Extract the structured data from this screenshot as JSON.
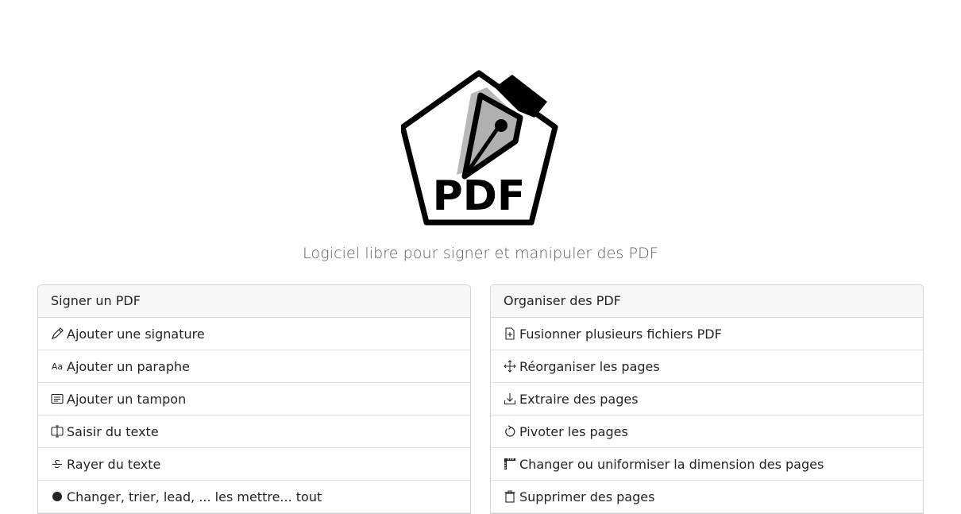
{
  "tagline": "Logiciel libre pour signer et manipuler des PDF",
  "logo": {
    "text": "PDF"
  },
  "sign_card": {
    "title": "Signer un PDF",
    "items": [
      {
        "label": "Ajouter une signature",
        "icon": "pen-icon"
      },
      {
        "label": "Ajouter un paraphe",
        "icon": "font-initials-icon",
        "icon_text": "Aa"
      },
      {
        "label": "Ajouter un tampon",
        "icon": "card-text-icon"
      },
      {
        "label": "Saisir du texte",
        "icon": "input-cursor-text-icon"
      },
      {
        "label": "Rayer du texte",
        "icon": "strikethrough-icon"
      },
      {
        "label": "Changer, trier, lead, ... les mettre... tout",
        "icon": "info-icon"
      }
    ]
  },
  "organize_card": {
    "title": "Organiser des PDF",
    "items": [
      {
        "label": "Fusionner plusieurs fichiers PDF",
        "icon": "file-plus-icon"
      },
      {
        "label": "Réorganiser les pages",
        "icon": "arrows-move-icon"
      },
      {
        "label": "Extraire des pages",
        "icon": "download-icon"
      },
      {
        "label": "Pivoter les pages",
        "icon": "rotate-icon"
      },
      {
        "label": "Changer ou uniformiser la dimension des pages",
        "icon": "rulers-icon"
      },
      {
        "label": "Supprimer des pages",
        "icon": "trash-icon"
      }
    ]
  }
}
